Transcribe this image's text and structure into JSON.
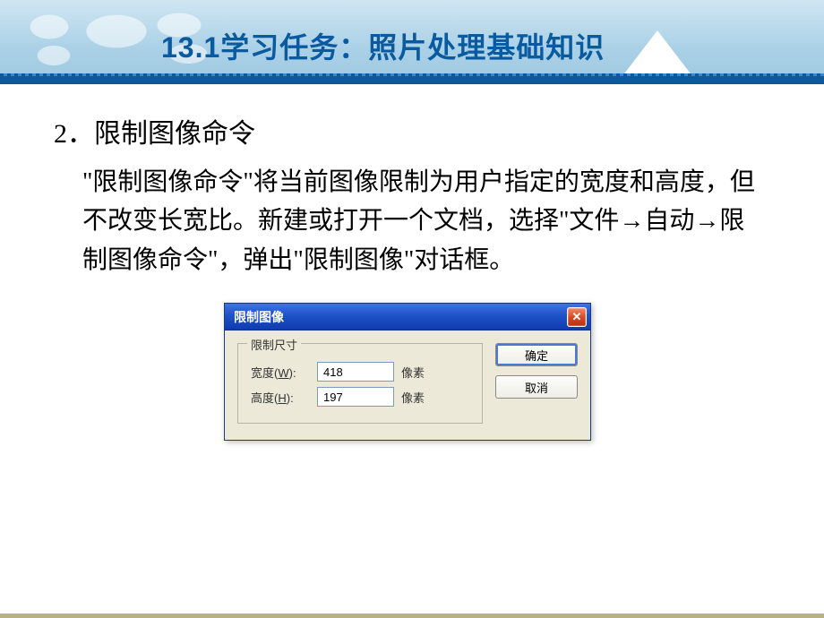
{
  "slide": {
    "title": "13.1学习任务：照片处理基础知识",
    "section_heading": "2．限制图像命令",
    "body": "\"限制图像命令\"将当前图像限制为用户指定的宽度和高度，但不改变长宽比。新建或打开一个文档，选择\"文件→自动→限制图像命令\"，弹出\"限制图像\"对话框。"
  },
  "dialog": {
    "title": "限制图像",
    "close_glyph": "✕",
    "group_label": "限制尺寸",
    "width_label_pre": "宽度(",
    "width_hotkey": "W",
    "width_label_post": "):",
    "width_value": "418",
    "height_label_pre": "高度(",
    "height_hotkey": "H",
    "height_label_post": "):",
    "height_value": "197",
    "unit": "像素",
    "ok_label": "确定",
    "cancel_label": "取消"
  }
}
